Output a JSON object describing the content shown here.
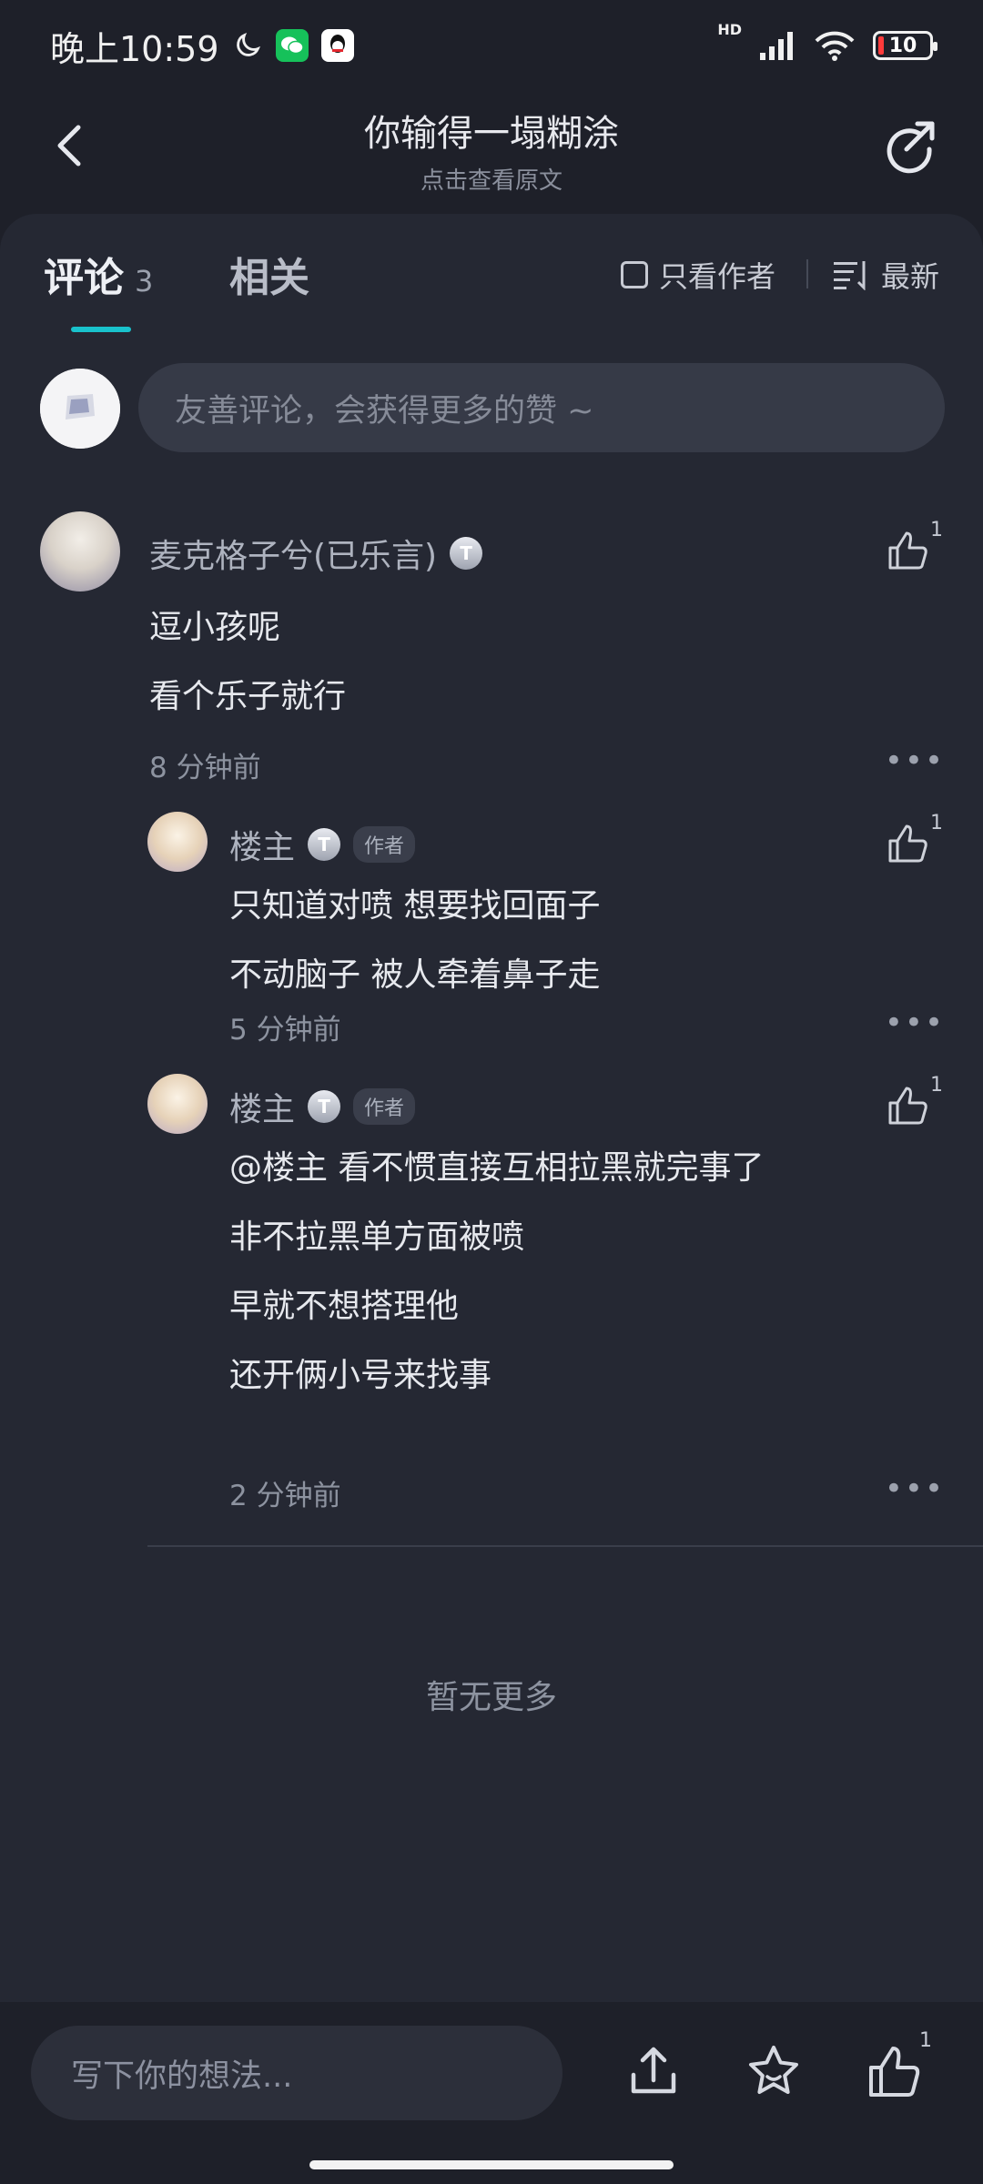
{
  "status_bar": {
    "time": "晚上10:59",
    "network": "HD",
    "battery": "10"
  },
  "header": {
    "title": "你输得一塌糊涂",
    "subtitle": "点击查看原文"
  },
  "tabs": {
    "comments_label": "评论",
    "comments_count": "3",
    "related_label": "相关",
    "author_only_label": "只看作者",
    "sort_label": "最新"
  },
  "compose": {
    "placeholder": "友善评论，会获得更多的赞 ~"
  },
  "comments": [
    {
      "user": "麦克格子兮(已乐言)",
      "level": "T",
      "likes": "1",
      "lines": [
        "逗小孩呢",
        "看个乐子就行"
      ],
      "time": "8 分钟前"
    },
    {
      "user": "楼主",
      "level": "T",
      "tag": "作者",
      "likes": "1",
      "lines": [
        "只知道对喷 想要找回面子",
        "不动脑子 被人牵着鼻子走"
      ],
      "time": "5 分钟前"
    },
    {
      "user": "楼主",
      "level": "T",
      "tag": "作者",
      "likes": "1",
      "lines": [
        "@楼主  看不惯直接互相拉黑就完事了",
        "非不拉黑单方面被喷",
        "早就不想搭理他",
        "还开俩小号来找事"
      ],
      "time": "2 分钟前"
    }
  ],
  "more_symbol": "•••",
  "footer_text": "暂无更多",
  "bottom": {
    "placeholder": "写下你的想法...",
    "like_count": "1"
  },
  "colors": {
    "background": "#1e2029",
    "panel": "#252833",
    "accent": "#19c2cc"
  }
}
